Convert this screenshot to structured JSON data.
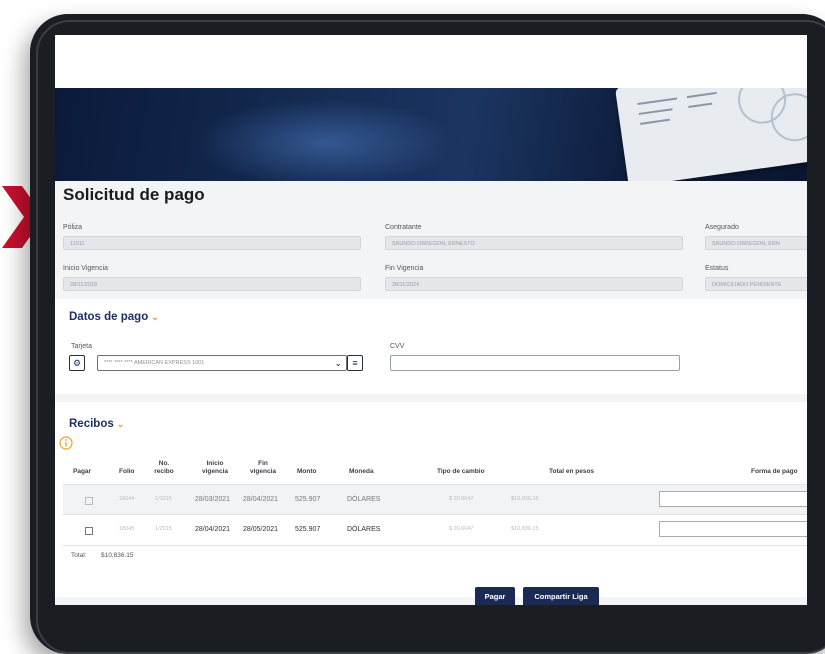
{
  "page": {
    "title": "Solicitud de pago"
  },
  "policy": {
    "poliza_label": "Póliza",
    "poliza_value": "11911",
    "contratante_label": "Contratante",
    "contratante_value": "SAUNDO OBREGON, ERNESTO",
    "asegurado_label": "Asegurado",
    "asegurado_value": "SAUNDO OBREGON, ERN",
    "inicio_label": "Inicio Vigencia",
    "inicio_value": "28/11/2018",
    "fin_label": "Fin Vigencia",
    "fin_value": "28/11/2024",
    "estatus_label": "Estatus",
    "estatus_value": "DOMICILIADO PENDIENTE"
  },
  "pago": {
    "section_title": "Datos de pago",
    "tarjeta_label": "Tarjeta",
    "tarjeta_value": "**** **** **** AMERICAN EXPRESS 1001",
    "cvv_label": "CVV"
  },
  "recibos": {
    "section_title": "Recibos",
    "columns": [
      "Pagar",
      "Folio",
      "No. recibo",
      "Inicio vigencia",
      "Fin vigencia",
      "Monto",
      "Moneda",
      "Tipo de cambio",
      "Total en pesos",
      "Forma de pago"
    ],
    "rows": [
      {
        "folio": "18044",
        "recibo": "1/1015",
        "inicio": "28/03/2021",
        "fin": "28/04/2021",
        "monto": "525.907",
        "moneda": "DÓLARES",
        "tipo_cambio": "$ 20.6047",
        "total": "$10,836.15"
      },
      {
        "folio": "18045",
        "recibo": "1/2015",
        "inicio": "28/04/2021",
        "fin": "28/05/2021",
        "monto": "525.907",
        "moneda": "DÓLARES",
        "tipo_cambio": "$ 20.6047",
        "total": "$10,836.15"
      }
    ],
    "total_label": "Total:",
    "total_value": "$10,836.15"
  },
  "actions": {
    "pagar": "Pagar",
    "compartir": "Compartir Liga"
  },
  "colors": {
    "navy": "#1d2f63",
    "accent_arrow": "#c8102e",
    "chevron": "#f0a020"
  }
}
